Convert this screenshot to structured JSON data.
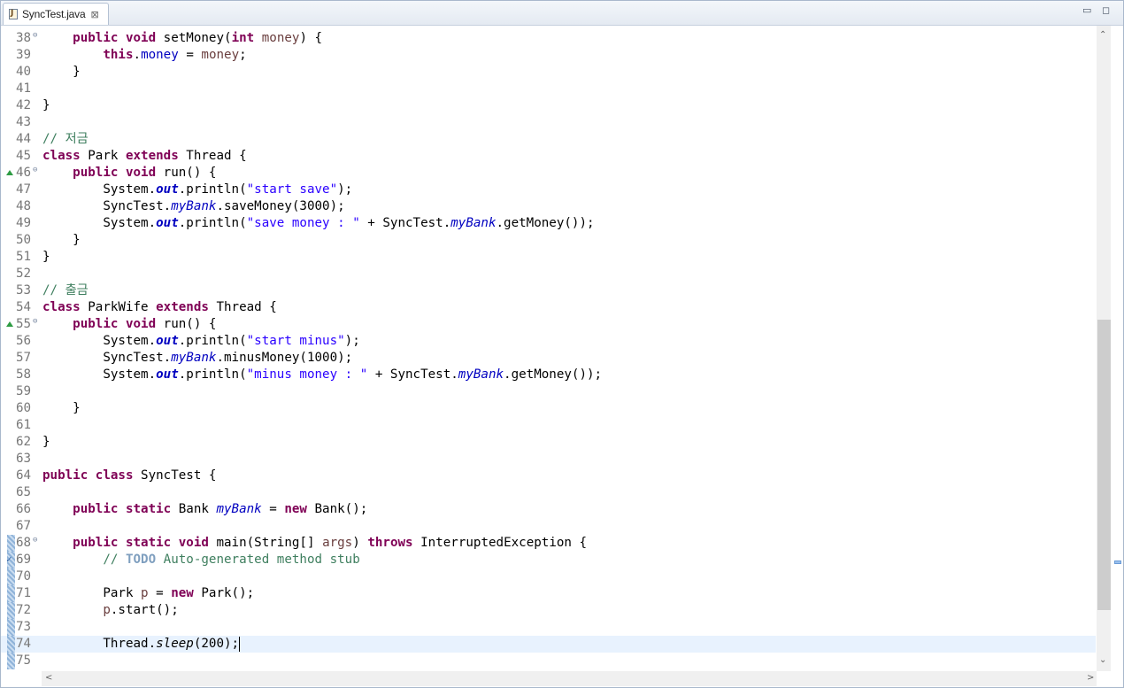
{
  "tab": {
    "title": "SyncTest.java",
    "close_glyph": "⊠"
  },
  "window_controls": {
    "minimize": "▭",
    "maximize": "◻"
  },
  "scrollbar": {
    "up": "⌃",
    "down": "⌄",
    "left": "<",
    "right": ">"
  },
  "editor": {
    "current_line": 74,
    "lines": [
      {
        "n": "38",
        "fold": "⊖",
        "tokens": [
          [
            "",
            "    "
          ],
          [
            "kw",
            "public"
          ],
          [
            "",
            " "
          ],
          [
            "kw",
            "void"
          ],
          [
            "",
            " setMoney("
          ],
          [
            "kw",
            "int"
          ],
          [
            "",
            " "
          ],
          [
            "param",
            "money"
          ],
          [
            "",
            ") {"
          ]
        ]
      },
      {
        "n": "39",
        "tokens": [
          [
            "",
            "        "
          ],
          [
            "kw",
            "this"
          ],
          [
            "",
            "."
          ],
          [
            "fld",
            "money"
          ],
          [
            "",
            " = "
          ],
          [
            "param",
            "money"
          ],
          [
            "",
            ";"
          ]
        ]
      },
      {
        "n": "40",
        "tokens": [
          [
            "",
            "    }"
          ]
        ]
      },
      {
        "n": "41",
        "tokens": []
      },
      {
        "n": "42",
        "tokens": [
          [
            "",
            "}"
          ]
        ]
      },
      {
        "n": "43",
        "tokens": []
      },
      {
        "n": "44",
        "tokens": [
          [
            "cmt",
            "// 저금"
          ]
        ]
      },
      {
        "n": "45",
        "tokens": [
          [
            "kw",
            "class"
          ],
          [
            "",
            " Park "
          ],
          [
            "kw",
            "extends"
          ],
          [
            "",
            " Thread {"
          ]
        ]
      },
      {
        "n": "46",
        "fold": "⊖",
        "override": true,
        "tokens": [
          [
            "",
            "    "
          ],
          [
            "kw",
            "public"
          ],
          [
            "",
            " "
          ],
          [
            "kw",
            "void"
          ],
          [
            "",
            " run() {"
          ]
        ]
      },
      {
        "n": "47",
        "tokens": [
          [
            "",
            "        System."
          ],
          [
            "sfb",
            "out"
          ],
          [
            "",
            ".println("
          ],
          [
            "str",
            "\"start save\""
          ],
          [
            "",
            ");"
          ]
        ]
      },
      {
        "n": "48",
        "tokens": [
          [
            "",
            "        SyncTest."
          ],
          [
            "sfld",
            "myBank"
          ],
          [
            "",
            ".saveMoney(3000);"
          ]
        ]
      },
      {
        "n": "49",
        "tokens": [
          [
            "",
            "        System."
          ],
          [
            "sfb",
            "out"
          ],
          [
            "",
            ".println("
          ],
          [
            "str",
            "\"save money : \""
          ],
          [
            "",
            " + SyncTest."
          ],
          [
            "sfld",
            "myBank"
          ],
          [
            "",
            ".getMoney());"
          ]
        ]
      },
      {
        "n": "50",
        "tokens": [
          [
            "",
            "    }"
          ]
        ]
      },
      {
        "n": "51",
        "tokens": [
          [
            "",
            "}"
          ]
        ]
      },
      {
        "n": "52",
        "tokens": []
      },
      {
        "n": "53",
        "tokens": [
          [
            "cmt",
            "// 출금"
          ]
        ]
      },
      {
        "n": "54",
        "tokens": [
          [
            "kw",
            "class"
          ],
          [
            "",
            " ParkWife "
          ],
          [
            "kw",
            "extends"
          ],
          [
            "",
            " Thread {"
          ]
        ]
      },
      {
        "n": "55",
        "fold": "⊖",
        "override": true,
        "tokens": [
          [
            "",
            "    "
          ],
          [
            "kw",
            "public"
          ],
          [
            "",
            " "
          ],
          [
            "kw",
            "void"
          ],
          [
            "",
            " run() {"
          ]
        ]
      },
      {
        "n": "56",
        "tokens": [
          [
            "",
            "        System."
          ],
          [
            "sfb",
            "out"
          ],
          [
            "",
            ".println("
          ],
          [
            "str",
            "\"start minus\""
          ],
          [
            "",
            ");"
          ]
        ]
      },
      {
        "n": "57",
        "tokens": [
          [
            "",
            "        SyncTest."
          ],
          [
            "sfld",
            "myBank"
          ],
          [
            "",
            ".minusMoney(1000);"
          ]
        ]
      },
      {
        "n": "58",
        "tokens": [
          [
            "",
            "        System."
          ],
          [
            "sfb",
            "out"
          ],
          [
            "",
            ".println("
          ],
          [
            "str",
            "\"minus money : \""
          ],
          [
            "",
            " + SyncTest."
          ],
          [
            "sfld",
            "myBank"
          ],
          [
            "",
            ".getMoney());"
          ]
        ]
      },
      {
        "n": "59",
        "tokens": []
      },
      {
        "n": "60",
        "tokens": [
          [
            "",
            "    }"
          ]
        ]
      },
      {
        "n": "61",
        "tokens": []
      },
      {
        "n": "62",
        "tokens": [
          [
            "",
            "}"
          ]
        ]
      },
      {
        "n": "63",
        "tokens": []
      },
      {
        "n": "64",
        "tokens": [
          [
            "kw",
            "public"
          ],
          [
            "",
            " "
          ],
          [
            "kw",
            "class"
          ],
          [
            "",
            " SyncTest {"
          ]
        ]
      },
      {
        "n": "65",
        "tokens": []
      },
      {
        "n": "66",
        "tokens": [
          [
            "",
            "    "
          ],
          [
            "kw",
            "public"
          ],
          [
            "",
            " "
          ],
          [
            "kw",
            "static"
          ],
          [
            "",
            " Bank "
          ],
          [
            "sfld",
            "myBank"
          ],
          [
            "",
            " = "
          ],
          [
            "kw",
            "new"
          ],
          [
            "",
            " Bank();"
          ]
        ]
      },
      {
        "n": "67",
        "tokens": []
      },
      {
        "n": "68",
        "fold": "⊖",
        "changed": true,
        "tokens": [
          [
            "",
            "    "
          ],
          [
            "kw",
            "public"
          ],
          [
            "",
            " "
          ],
          [
            "kw",
            "static"
          ],
          [
            "",
            " "
          ],
          [
            "kw",
            "void"
          ],
          [
            "",
            " main(String[] "
          ],
          [
            "param",
            "args"
          ],
          [
            "",
            ") "
          ],
          [
            "kw",
            "throws"
          ],
          [
            "",
            " InterruptedException {"
          ]
        ]
      },
      {
        "n": "69",
        "changed": true,
        "task": true,
        "tokens": [
          [
            "",
            "        "
          ],
          [
            "cmt",
            "// "
          ],
          [
            "todo",
            "TODO"
          ],
          [
            "cmt",
            " Auto-generated method stub"
          ]
        ]
      },
      {
        "n": "70",
        "changed": true,
        "tokens": []
      },
      {
        "n": "71",
        "changed": true,
        "tokens": [
          [
            "",
            "        Park "
          ],
          [
            "param",
            "p"
          ],
          [
            "",
            " = "
          ],
          [
            "kw",
            "new"
          ],
          [
            "",
            " Park();"
          ]
        ]
      },
      {
        "n": "72",
        "changed": true,
        "tokens": [
          [
            "",
            "        "
          ],
          [
            "param",
            "p"
          ],
          [
            "",
            ".start();"
          ]
        ]
      },
      {
        "n": "73",
        "changed": true,
        "tokens": []
      },
      {
        "n": "74",
        "changed": true,
        "caret": true,
        "tokens": [
          [
            "",
            "        Thread."
          ],
          [
            "smth",
            "sleep"
          ],
          [
            "",
            "(200);"
          ]
        ]
      },
      {
        "n": "75",
        "changed": true,
        "tokens": []
      }
    ]
  }
}
